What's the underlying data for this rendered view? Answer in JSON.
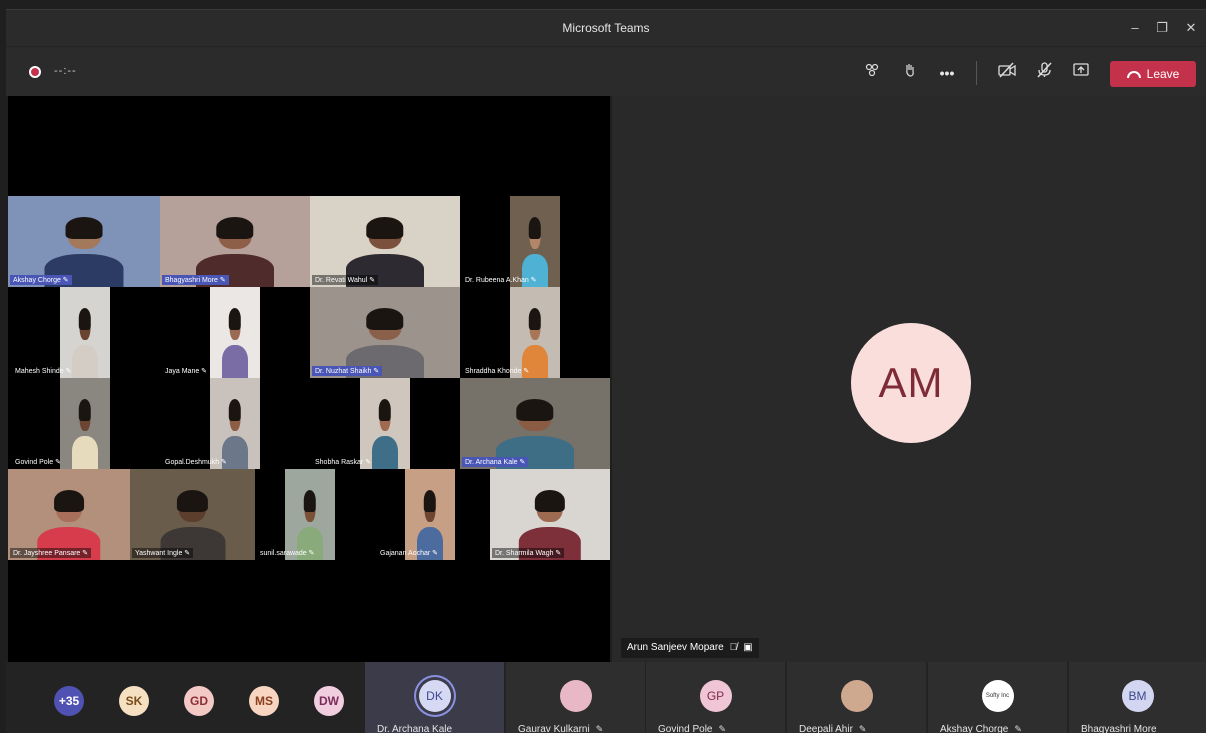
{
  "window": {
    "title": "Microsoft Teams",
    "minimize": "–",
    "restore": "❐",
    "close": "✕"
  },
  "toolbar": {
    "recording_time": "--:--",
    "participants_icon": "people-icon",
    "raise_hand_icon": "hand-icon",
    "more_icon": "more-icon",
    "camera_icon": "camera-off-icon",
    "mic_icon": "mic-off-icon",
    "share_icon": "share-icon",
    "leave_label": "Leave"
  },
  "shared_screen": {
    "tiles": [
      {
        "name": "Akshay Chorge",
        "bg": "#7f92b8",
        "skin": "#a4785a",
        "shirt": "#2c3b63"
      },
      {
        "name": "Bhagyashri More",
        "bg": "#b6a19a",
        "skin": "#8e5e48",
        "shirt": "#4f2b2b"
      },
      {
        "name": "Dr. Revati Wahul",
        "bg": "#d9d2c6",
        "skin": "#7b513d",
        "shirt": "#2d2a31"
      },
      {
        "name": "Dr. Rubeena A.Khan",
        "bg": "#6f6050",
        "skin": "#b38669",
        "shirt": "#4fb1d4"
      },
      {
        "name": "Mahesh Shinde",
        "bg": "#d6d4d1",
        "skin": "#6a4431",
        "shirt": "#d3cdc6"
      },
      {
        "name": "Jaya Mane",
        "bg": "#ebe7e4",
        "skin": "#9a6a54",
        "shirt": "#7a6da5"
      },
      {
        "name": "Dr. Nuzhat Shaikh",
        "bg": "#9c948c",
        "skin": "#8a604b",
        "shirt": "#6c6a6e"
      },
      {
        "name": "Shraddha Khonde",
        "bg": "#c4bbb3",
        "skin": "#a97558",
        "shirt": "#e0863a"
      },
      {
        "name": "Govind Pole",
        "bg": "#8a8680",
        "skin": "#6d4633",
        "shirt": "#e7dbbd"
      },
      {
        "name": "Gopal.Deshmukh",
        "bg": "#c9c2bc",
        "skin": "#8e5d46",
        "shirt": "#6c7789"
      },
      {
        "name": "Shobha Raskar",
        "bg": "#cfc7bd",
        "skin": "#9f6a51",
        "shirt": "#3f6e89"
      },
      {
        "name": "Dr. Archana Kale",
        "bg": "#767169",
        "skin": "#8a5c44",
        "shirt": "#3e6d86"
      },
      {
        "name": "Dr. Jayshree Pansare",
        "bg": "#b3907c",
        "skin": "#a8705a",
        "shirt": "#d63c4b"
      },
      {
        "name": "Yashwant Ingle",
        "bg": "#6a5c4b",
        "skin": "#5c3e2c",
        "shirt": "#3d3836"
      },
      {
        "name": "sunil.sarawade",
        "bg": "#9da79e",
        "skin": "#7a5037",
        "shirt": "#89aa7a"
      },
      {
        "name": "Gajanan Aochar",
        "bg": "#c79f84",
        "skin": "#6e4531",
        "shirt": "#4c6b9f"
      },
      {
        "name": "Dr. Sharmila Wagh",
        "bg": "#d9d6d2",
        "skin": "#9e6a52",
        "shirt": "#7d2f3a"
      }
    ]
  },
  "stage": {
    "initials": "AM",
    "name": "Arun Sanjeev Mopare"
  },
  "strip": {
    "overflow": "+35",
    "small_avatars": [
      {
        "initials": "SK",
        "bg": "#f5e1c2",
        "fg": "#7a4d1b"
      },
      {
        "initials": "GD",
        "bg": "#f3c9c6",
        "fg": "#8a2f35"
      },
      {
        "initials": "MS",
        "bg": "#f7d5c0",
        "fg": "#8a3e1c"
      },
      {
        "initials": "DW",
        "bg": "#f1cde0",
        "fg": "#7a2c5a"
      }
    ],
    "participants": [
      {
        "initials": "DK",
        "name": "Dr. Archana Kale",
        "bg": "#d6d9f3",
        "fg": "#3e468a"
      },
      {
        "initials": "",
        "name": "Gaurav Kulkarni",
        "bg": "#e9b8c6",
        "fg": "#333"
      },
      {
        "initials": "GP",
        "name": "Govind Pole",
        "bg": "#f0c6d6",
        "fg": "#7d2a4c"
      },
      {
        "initials": "",
        "name": "Deepali Ahir",
        "bg": "#cfa98f",
        "fg": "#333"
      },
      {
        "initials": "Softy Inc",
        "name": "Akshay Chorge",
        "bg": "#ffffff",
        "fg": "#333"
      },
      {
        "initials": "BM",
        "name": "Bhagyashri More",
        "bg": "#d2d6f1",
        "fg": "#3e468a"
      }
    ]
  }
}
